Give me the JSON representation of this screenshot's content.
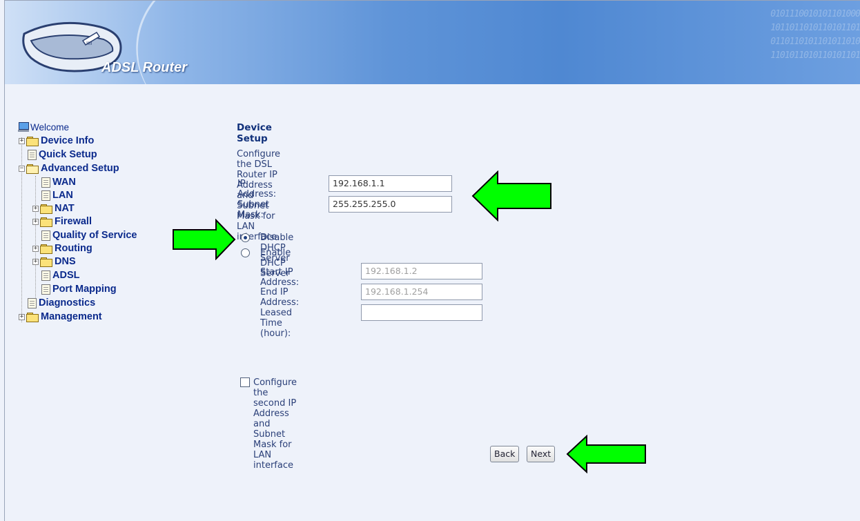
{
  "banner": {
    "title": "ADSL Router",
    "binary_text": "0101110010101101000\n1011011010110101101\n0110110101101011010\n1101011010110101101"
  },
  "sidebar": {
    "items": [
      {
        "label": "Welcome",
        "icon": "computer-icon"
      },
      {
        "label": "Device Info",
        "icon": "folder-icon"
      },
      {
        "label": "Quick Setup",
        "icon": "document-icon"
      },
      {
        "label": "Advanced Setup",
        "icon": "open-folder-icon"
      },
      {
        "label": "WAN",
        "icon": "document-icon"
      },
      {
        "label": "LAN",
        "icon": "document-icon"
      },
      {
        "label": "NAT",
        "icon": "folder-icon"
      },
      {
        "label": "Firewall",
        "icon": "folder-icon"
      },
      {
        "label": "Quality of Service",
        "icon": "document-icon"
      },
      {
        "label": "Routing",
        "icon": "folder-icon"
      },
      {
        "label": "DNS",
        "icon": "folder-icon"
      },
      {
        "label": "ADSL",
        "icon": "document-icon"
      },
      {
        "label": "Port Mapping",
        "icon": "document-icon"
      },
      {
        "label": "Diagnostics",
        "icon": "document-icon"
      },
      {
        "label": "Management",
        "icon": "folder-icon"
      }
    ]
  },
  "form": {
    "title": "Device Setup",
    "description": "Configure the DSL Router IP Address and Subnet Mask for LAN interface.",
    "ip_label": "IP Address:",
    "ip_value": "192.168.1.1",
    "mask_label": "Subnet Mask:",
    "mask_value": "255.255.255.0",
    "dhcp_disable_label": "Disable DHCP Server",
    "dhcp_enable_label": "Enable DHCP Server",
    "dhcp_selected": "disable",
    "start_ip_label": "Start IP Address:",
    "start_ip_value": "192.168.1.2",
    "end_ip_label": "End IP Address:",
    "end_ip_value": "192.168.1.254",
    "lease_label": "Leased Time (hour):",
    "lease_value": "",
    "second_ip_label": "Configure the second IP Address and Subnet Mask for LAN interface",
    "second_ip_checked": false
  },
  "buttons": {
    "back": "Back",
    "next": "Next"
  },
  "annotations": {
    "arrow_color": "#00ff00",
    "arrow_outline": "#000000"
  }
}
